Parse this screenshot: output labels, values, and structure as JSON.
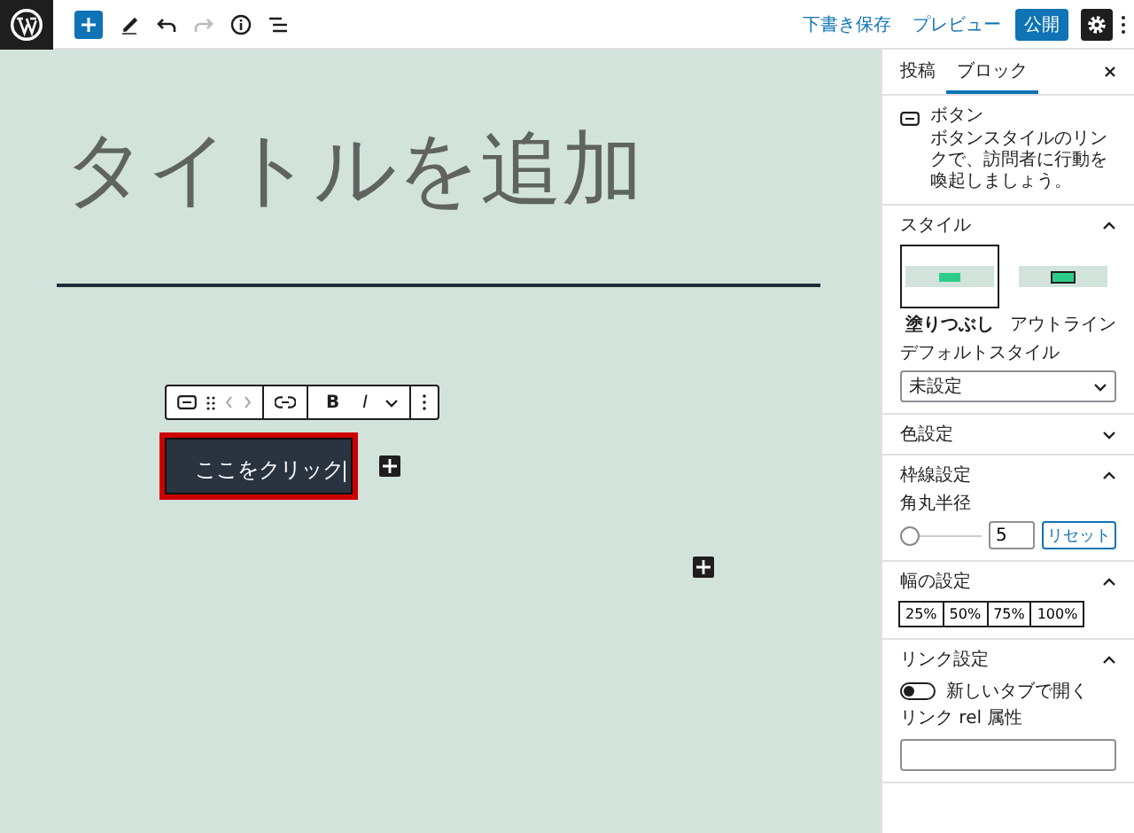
{
  "toolbar": {
    "actions": [
      {
        "label": "下書き保存",
        "kind": "link"
      },
      {
        "label": "プレビュー",
        "kind": "link"
      },
      {
        "label": "公開",
        "kind": "primary"
      }
    ],
    "settings_open": true
  },
  "editor": {
    "title_placeholder": "タイトルを追加",
    "block_toolbar": {
      "bold": "B",
      "italic": "I"
    },
    "button_text": "ここをクリック",
    "selected": true
  },
  "sidebar": {
    "tabs": [
      {
        "label": "投稿",
        "selected": false
      },
      {
        "label": "ブロック",
        "selected": true
      }
    ],
    "block": {
      "name": "ボタン",
      "description": "ボタンスタイルのリンクで、訪問者に行動を喚起しましょう。"
    },
    "panels": [
      {
        "kind": "styles",
        "title": "スタイル",
        "expanded": true,
        "styles": [
          {
            "label": "塗りつぶし",
            "selected": true,
            "kind": "fill"
          },
          {
            "label": "アウトライン",
            "selected": false,
            "kind": "outline"
          }
        ],
        "default_label": "デフォルトスタイル",
        "default_value": "未設定"
      },
      {
        "kind": "plain",
        "title": "色設定",
        "expanded": false
      },
      {
        "kind": "border",
        "title": "枠線設定",
        "expanded": true,
        "label": "角丸半径",
        "level": 0,
        "value": "5",
        "reset": "リセット"
      },
      {
        "kind": "width",
        "title": "幅の設定",
        "expanded": true,
        "options": [
          {
            "label": "25%",
            "selected": false
          },
          {
            "label": "50%",
            "selected": false
          },
          {
            "label": "75%",
            "selected": false
          },
          {
            "label": "100%",
            "selected": false
          }
        ]
      },
      {
        "kind": "link",
        "title": "リンク設定",
        "expanded": true,
        "toggle": {
          "label": "新しいタブで開く",
          "on": false
        },
        "rel_label": "リンク rel 属性"
      }
    ]
  }
}
